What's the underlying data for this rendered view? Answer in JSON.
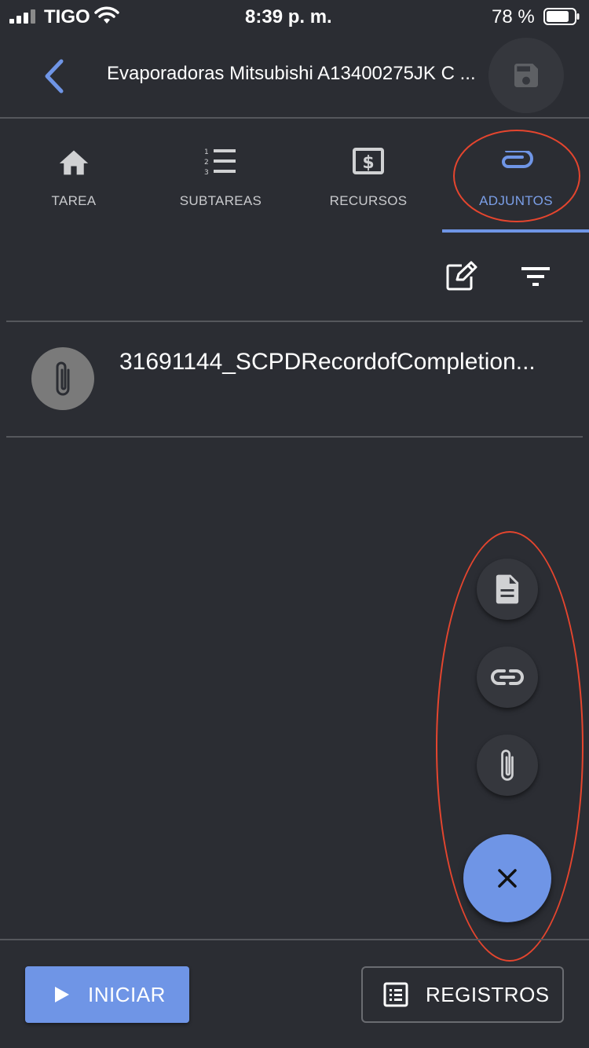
{
  "status_bar": {
    "carrier": "TIGO",
    "time": "8:39 p. m.",
    "battery": "78 %"
  },
  "header": {
    "title": "Evaporadoras Mitsubishi A13400275JK C ...",
    "back_icon": "chevron-left-icon",
    "save_icon": "floppy-disk-icon"
  },
  "tabs": [
    {
      "label": "TAREA",
      "icon": "home-icon",
      "active": false
    },
    {
      "label": "SUBTAREAS",
      "icon": "numbered-list-icon",
      "active": false
    },
    {
      "label": "RECURSOS",
      "icon": "dollar-box-icon",
      "active": false
    },
    {
      "label": "ADJUNTOS",
      "icon": "paperclip-icon",
      "active": true
    }
  ],
  "toolbar": {
    "edit_icon": "edit-icon",
    "filter_icon": "filter-icon"
  },
  "attachments": [
    {
      "name": "31691144_SCPDRecordofCompletion...",
      "icon": "paperclip-icon"
    }
  ],
  "fab_menu": {
    "actions": [
      {
        "icon": "document-icon"
      },
      {
        "icon": "link-icon"
      },
      {
        "icon": "paperclip-icon"
      }
    ],
    "close_icon": "close-icon"
  },
  "bottom_bar": {
    "start_label": "INICIAR",
    "records_label": "REGISTROS"
  },
  "colors": {
    "background": "#2b2d33",
    "accent": "#6f95e6",
    "highlight": "#e5452e"
  }
}
